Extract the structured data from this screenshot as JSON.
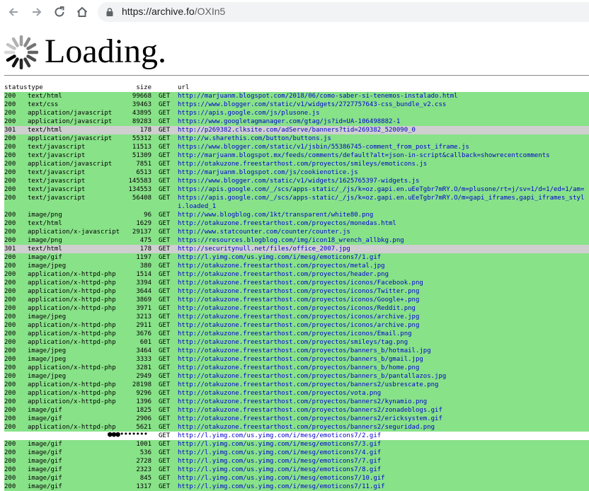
{
  "browser": {
    "url_host": "https://archive.fo",
    "url_path": "/OXIn5",
    "back_icon": "arrow-left-icon",
    "forward_icon": "arrow-right-icon",
    "reload_icon": "reload-icon",
    "home_icon": "home-icon",
    "lock_icon": "lock-icon"
  },
  "loading": {
    "title": "Loading.",
    "spinner_icon": "spinner-icon"
  },
  "colors": {
    "ok_row": "#88e288",
    "redirect_row": "#cfcfcf",
    "pending_row": "#ffffff",
    "link": "#0000cc"
  },
  "table": {
    "headers": {
      "status": "status",
      "type": "type",
      "size": "size",
      "url": "url"
    },
    "rows": [
      {
        "status": "200",
        "type": "text/html",
        "size": "99668",
        "method": "GET",
        "url": "http://marjuanm.blogspot.com/2018/06/como-saber-si-tenemos-instalado.html",
        "state": "ok"
      },
      {
        "status": "200",
        "type": "text/css",
        "size": "39463",
        "method": "GET",
        "url": "https://www.blogger.com/static/v1/widgets/2727757643-css_bundle_v2.css",
        "state": "ok"
      },
      {
        "status": "200",
        "type": "application/javascript",
        "size": "43895",
        "method": "GET",
        "url": "https://apis.google.com/js/plusone.js",
        "state": "ok"
      },
      {
        "status": "200",
        "type": "application/javascript",
        "size": "89283",
        "method": "GET",
        "url": "https://www.googletagmanager.com/gtag/js?id=UA-106498882-1",
        "state": "ok"
      },
      {
        "status": "301",
        "type": "text/html",
        "size": "178",
        "method": "GET",
        "url": "http://p269382.clksite.com/adServe/banners?tid=269382_520090_0",
        "state": "redirect"
      },
      {
        "status": "200",
        "type": "application/javascript",
        "size": "55312",
        "method": "GET",
        "url": "http://w.sharethis.com/button/buttons.js",
        "state": "ok"
      },
      {
        "status": "200",
        "type": "text/javascript",
        "size": "11513",
        "method": "GET",
        "url": "https://www.blogger.com/static/v1/jsbin/55386745-comment_from_post_iframe.js",
        "state": "ok"
      },
      {
        "status": "200",
        "type": "text/javascript",
        "size": "51309",
        "method": "GET",
        "url": "http://marjuanm.blogspot.mx/feeds/comments/default?alt=json-in-script&callback=showrecentcomments",
        "state": "ok"
      },
      {
        "status": "200",
        "type": "application/javascript",
        "size": "7851",
        "method": "GET",
        "url": "http://otakuzone.freestarthost.com/proyectos/smileys/emoticons.js",
        "state": "ok"
      },
      {
        "status": "200",
        "type": "text/javascript",
        "size": "6513",
        "method": "GET",
        "url": "http://marjuanm.blogspot.com/js/cookienotice.js",
        "state": "ok"
      },
      {
        "status": "200",
        "type": "text/javascript",
        "size": "145583",
        "method": "GET",
        "url": "https://www.blogger.com/static/v1/widgets/1625765397-widgets.js",
        "state": "ok"
      },
      {
        "status": "200",
        "type": "text/javascript",
        "size": "134553",
        "method": "GET",
        "url": "https://apis.google.com/_/scs/apps-static/_/js/k=oz.gapi.en.uEeTgbr7mRY.O/m=plusone/rt=j/sv=1/d=1/ed=1/am=",
        "state": "ok"
      },
      {
        "status": "200",
        "type": "text/javascript",
        "size": "56408",
        "method": "GET",
        "url": "https://apis.google.com/_/scs/apps-static/_/js/k=oz.gapi.en.uEeTgbr7mRY.O/m=gapi_iframes,gapi_iframes_styl\ni.loaded_1",
        "state": "ok",
        "wrap": true
      },
      {
        "status": "200",
        "type": "image/png",
        "size": "96",
        "method": "GET",
        "url": "http://www.blogblog.com/1kt/transparent/white80.png",
        "state": "ok"
      },
      {
        "status": "200",
        "type": "text/html",
        "size": "1629",
        "method": "GET",
        "url": "http://otakuzone.freestarthost.com/proyectos/monedas.html",
        "state": "ok"
      },
      {
        "status": "200",
        "type": "application/x-javascript",
        "size": "29137",
        "method": "GET",
        "url": "http://www.statcounter.com/counter/counter.js",
        "state": "ok"
      },
      {
        "status": "200",
        "type": "image/png",
        "size": "475",
        "method": "GET",
        "url": "https://resources.blogblog.com/img/icon18_wrench_allbkg.png",
        "state": "ok"
      },
      {
        "status": "301",
        "type": "text/html",
        "size": "178",
        "method": "GET",
        "url": "http://securitynull.net/files/office_2007.jpg",
        "state": "redirect"
      },
      {
        "status": "200",
        "type": "image/gif",
        "size": "1197",
        "method": "GET",
        "url": "http://l.yimg.com/us.yimg.com/i/mesg/emoticons7/1.gif",
        "state": "ok"
      },
      {
        "status": "200",
        "type": "image/jpeg",
        "size": "380",
        "method": "GET",
        "url": "http://otakuzone.freestarthost.com/proyectos/metal.jpg",
        "state": "ok"
      },
      {
        "status": "200",
        "type": "application/x-httpd-php",
        "size": "1514",
        "method": "GET",
        "url": "http://otakuzone.freestarthost.com/proyectos/header.png",
        "state": "ok"
      },
      {
        "status": "200",
        "type": "application/x-httpd-php",
        "size": "3394",
        "method": "GET",
        "url": "http://otakuzone.freestarthost.com/proyectos/iconos/Facebook.png",
        "state": "ok"
      },
      {
        "status": "200",
        "type": "application/x-httpd-php",
        "size": "3644",
        "method": "GET",
        "url": "http://otakuzone.freestarthost.com/proyectos/iconos/Twitter.png",
        "state": "ok"
      },
      {
        "status": "200",
        "type": "application/x-httpd-php",
        "size": "3869",
        "method": "GET",
        "url": "http://otakuzone.freestarthost.com/proyectos/iconos/Google+.png",
        "state": "ok"
      },
      {
        "status": "200",
        "type": "application/x-httpd-php",
        "size": "3971",
        "method": "GET",
        "url": "http://otakuzone.freestarthost.com/proyectos/iconos/Reddit.png",
        "state": "ok"
      },
      {
        "status": "200",
        "type": "image/jpeg",
        "size": "3213",
        "method": "GET",
        "url": "http://otakuzone.freestarthost.com/proyectos/iconos/archive.jpg",
        "state": "ok"
      },
      {
        "status": "200",
        "type": "application/x-httpd-php",
        "size": "2911",
        "method": "GET",
        "url": "http://otakuzone.freestarthost.com/proyectos/iconos/archive.png",
        "state": "ok"
      },
      {
        "status": "200",
        "type": "application/x-httpd-php",
        "size": "3676",
        "method": "GET",
        "url": "http://otakuzone.freestarthost.com/proyectos/iconos/Email.png",
        "state": "ok"
      },
      {
        "status": "200",
        "type": "application/x-httpd-php",
        "size": "601",
        "method": "GET",
        "url": "http://otakuzone.freestarthost.com/proyectos/smileys/tag.png",
        "state": "ok"
      },
      {
        "status": "200",
        "type": "image/jpeg",
        "size": "3464",
        "method": "GET",
        "url": "http://otakuzone.freestarthost.com/proyectos/banners_b/hotmail.jpg",
        "state": "ok"
      },
      {
        "status": "200",
        "type": "image/jpeg",
        "size": "3333",
        "method": "GET",
        "url": "http://otakuzone.freestarthost.com/proyectos/banners_b/gmail.jpg",
        "state": "ok"
      },
      {
        "status": "200",
        "type": "application/x-httpd-php",
        "size": "3281",
        "method": "GET",
        "url": "http://otakuzone.freestarthost.com/proyectos/banners_b/home.png",
        "state": "ok"
      },
      {
        "status": "200",
        "type": "image/jpeg",
        "size": "2949",
        "method": "GET",
        "url": "http://otakuzone.freestarthost.com/proyectos/banners_b/pantallazos.jpg",
        "state": "ok"
      },
      {
        "status": "200",
        "type": "application/x-httpd-php",
        "size": "28198",
        "method": "GET",
        "url": "http://otakuzone.freestarthost.com/proyectos/banners2/usbrescate.png",
        "state": "ok"
      },
      {
        "status": "200",
        "type": "application/x-httpd-php",
        "size": "9296",
        "method": "GET",
        "url": "http://otakuzone.freestarthost.com/proyectos/vota.png",
        "state": "ok"
      },
      {
        "status": "200",
        "type": "application/x-httpd-php",
        "size": "1396",
        "method": "GET",
        "url": "http://otakuzone.freestarthost.com/proyectos/banners2/kynamio.png",
        "state": "ok"
      },
      {
        "status": "200",
        "type": "image/gif",
        "size": "1825",
        "method": "GET",
        "url": "http://otakuzone.freestarthost.com/proyectos/banners2/zonadeblogs.gif",
        "state": "ok"
      },
      {
        "status": "200",
        "type": "image/gif",
        "size": "2906",
        "method": "GET",
        "url": "http://otakuzone.freestarthost.com/proyectos/banners2/ericksystem.gif",
        "state": "ok"
      },
      {
        "status": "200",
        "type": "application/x-httpd-php",
        "size": "5621",
        "method": "GET",
        "url": "http://otakuzone.freestarthost.com/proyectos/banners2/seguridad.png",
        "state": "ok"
      },
      {
        "status": "",
        "type": "",
        "size": "",
        "method": "GET",
        "url": "http://l.yimg.com/us.yimg.com/i/mesg/emoticons7/2.gif",
        "state": "pending",
        "dots": "●●●•••••••"
      },
      {
        "status": "200",
        "type": "image/gif",
        "size": "1001",
        "method": "GET",
        "url": "http://l.yimg.com/us.yimg.com/i/mesg/emoticons7/3.gif",
        "state": "ok"
      },
      {
        "status": "200",
        "type": "image/gif",
        "size": "536",
        "method": "GET",
        "url": "http://l.yimg.com/us.yimg.com/i/mesg/emoticons7/4.gif",
        "state": "ok"
      },
      {
        "status": "200",
        "type": "image/gif",
        "size": "2728",
        "method": "GET",
        "url": "http://l.yimg.com/us.yimg.com/i/mesg/emoticons7/7.gif",
        "state": "ok"
      },
      {
        "status": "200",
        "type": "image/gif",
        "size": "2323",
        "method": "GET",
        "url": "http://l.yimg.com/us.yimg.com/i/mesg/emoticons7/8.gif",
        "state": "ok"
      },
      {
        "status": "200",
        "type": "image/gif",
        "size": "845",
        "method": "GET",
        "url": "http://l.yimg.com/us.yimg.com/i/mesg/emoticons7/10.gif",
        "state": "ok"
      },
      {
        "status": "200",
        "type": "image/gif",
        "size": "1317",
        "method": "GET",
        "url": "http://l.yimg.com/us.yimg.com/i/mesg/emoticons7/11.gif",
        "state": "ok"
      }
    ]
  }
}
